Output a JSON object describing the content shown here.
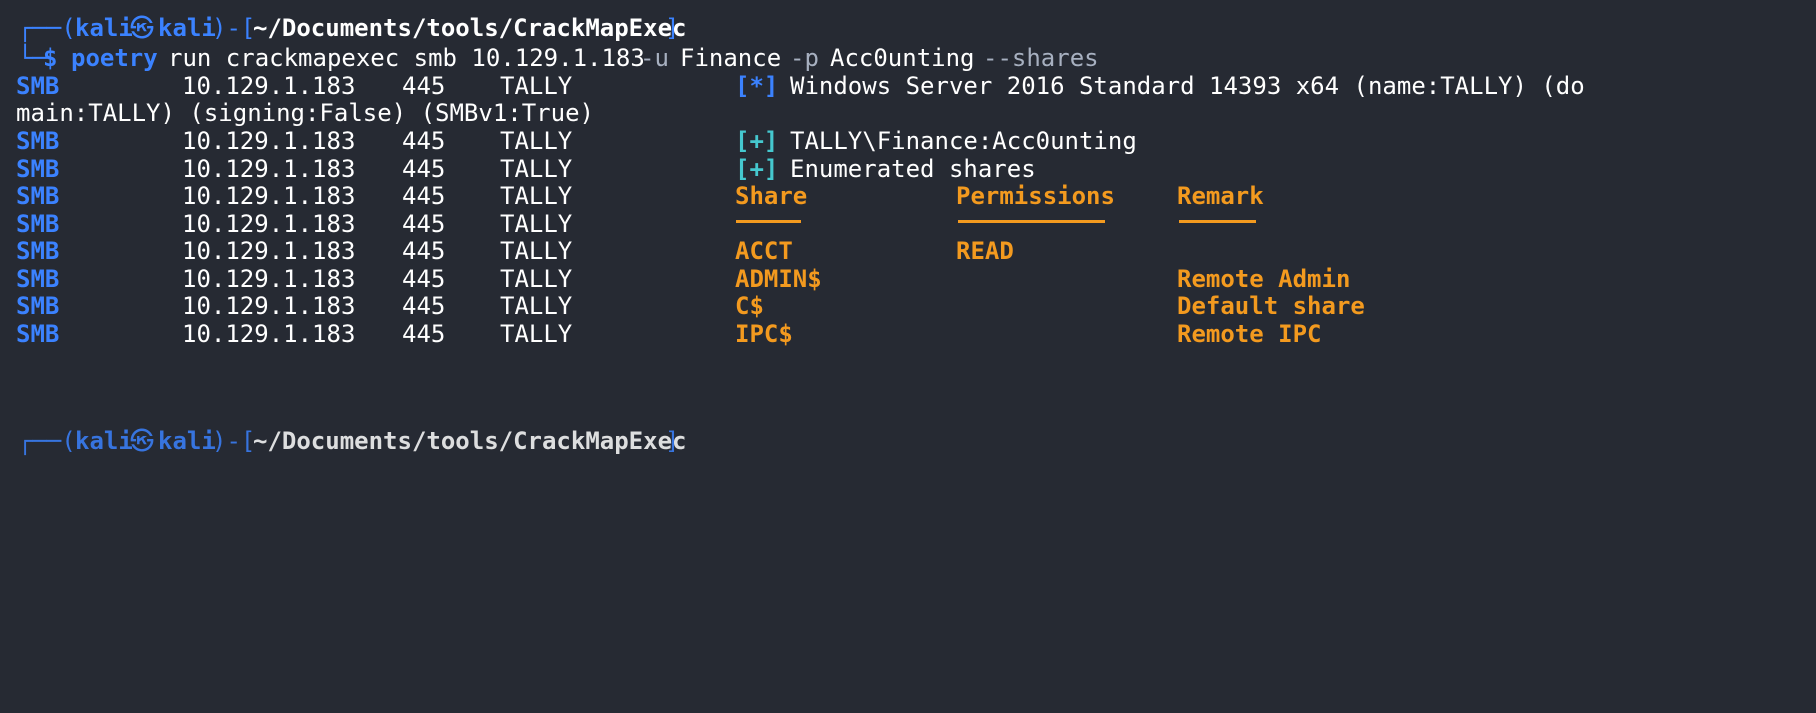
{
  "prompt": {
    "frame_top": "┌──(",
    "user": "kali",
    "at": "㉿",
    "host": "kali",
    "mid": ")-[",
    "path": "~/Documents/tools/CrackMapExec",
    "end": "]",
    "frame_bottom": "└─",
    "dollar": "$",
    "command": "poetry",
    "args_1": "run crackmapexec smb 10.129.1.183",
    "flag_u": "-u",
    "user_arg": "Finance",
    "flag_p": "-p",
    "pass_arg": "Acc0unting",
    "flag_shares": "--shares"
  },
  "rows": [
    {
      "proto": "SMB",
      "ip": "10.129.1.183",
      "port": "445",
      "host": "TALLY",
      "bracket": "[*]",
      "msg": "Windows Server 2016 Standard 14393 x64 (name:TALLY) (do"
    },
    {
      "continuation": "main:TALLY) (signing:False) (SMBv1:True)"
    },
    {
      "proto": "SMB",
      "ip": "10.129.1.183",
      "port": "445",
      "host": "TALLY",
      "bracket": "[+]",
      "msg": "TALLY\\Finance:Acc0unting"
    },
    {
      "proto": "SMB",
      "ip": "10.129.1.183",
      "port": "445",
      "host": "TALLY",
      "bracket": "[+]",
      "msg": "Enumerated shares"
    }
  ],
  "share_table": {
    "proto": "SMB",
    "ip": "10.129.1.183",
    "port": "445",
    "host": "TALLY",
    "headers": {
      "share": "Share",
      "permissions": "Permissions",
      "remark": "Remark"
    },
    "rows": [
      {
        "share": "ACCT",
        "permissions": "READ",
        "remark": ""
      },
      {
        "share": "ADMIN$",
        "permissions": "",
        "remark": "Remote Admin"
      },
      {
        "share": "C$",
        "permissions": "",
        "remark": "Default share"
      },
      {
        "share": "IPC$",
        "permissions": "",
        "remark": "Remote IPC"
      }
    ]
  },
  "next_prompt": {
    "frame_top": "┌──(",
    "user": "kali",
    "at": "㉿",
    "host": "kali",
    "mid": ")-[",
    "path": "~/Documents/tools/CrackMapExec",
    "end": "]"
  },
  "colors": {
    "background": "#262a33",
    "proto": "#3b82ff",
    "bracket": "#45c8cf",
    "header": "#f39a1f",
    "text": "#ffffff"
  }
}
